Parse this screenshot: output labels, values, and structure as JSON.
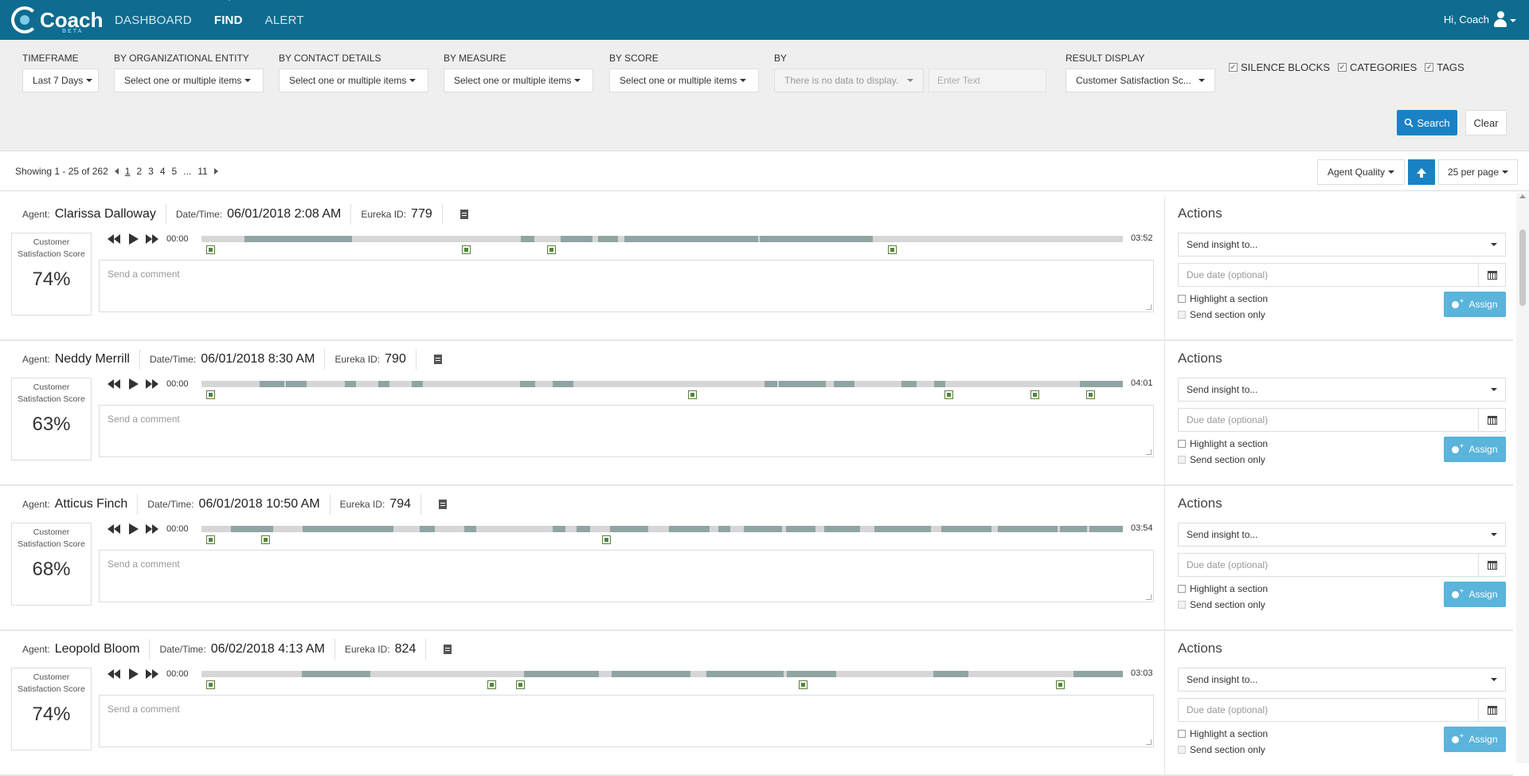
{
  "app": {
    "logo_text": "Coach",
    "logo_sub": "BETA",
    "nav": [
      {
        "label": "DASHBOARD",
        "active": false
      },
      {
        "label": "FIND",
        "active": true
      },
      {
        "label": "ALERT",
        "active": false
      }
    ],
    "greeting": "Hi, Coach"
  },
  "filters": {
    "timeframe": {
      "label": "TIMEFRAME",
      "value": "Last 7 Days"
    },
    "org_entity": {
      "label": "BY ORGANIZATIONAL ENTITY",
      "value": "Select one or multiple items"
    },
    "contact": {
      "label": "BY CONTACT DETAILS",
      "value": "Select one or multiple items"
    },
    "measure": {
      "label": "BY MEASURE",
      "value": "Select one or multiple items"
    },
    "score": {
      "label": "BY SCORE",
      "value": "Select one or multiple items"
    },
    "by": {
      "label": "BY",
      "value": "There is no data to display.",
      "text_placeholder": "Enter Text"
    },
    "result_display": {
      "label": "RESULT DISPLAY",
      "value": "Customer Satisfaction Sc..."
    },
    "checkboxes": [
      {
        "label": "SILENCE BLOCKS",
        "checked": true
      },
      {
        "label": "CATEGORIES",
        "checked": true
      },
      {
        "label": "TAGS",
        "checked": true
      }
    ],
    "search_label": "Search",
    "clear_label": "Clear"
  },
  "pager": {
    "showing": "Showing 1 - 25 of 262",
    "pages": [
      "1",
      "2",
      "3",
      "4",
      "5",
      "...",
      "11"
    ],
    "current_page": "1",
    "sort": "Agent Quality",
    "per_page": "25 per page"
  },
  "labels": {
    "agent": "Agent:",
    "datetime": "Date/Time:",
    "eureka": "Eureka ID:",
    "score_label": "Customer Satisfaction Score",
    "comment_placeholder": "Send a comment",
    "actions_title": "Actions",
    "send_insight": "Send insight to...",
    "due_date": "Due date (optional)",
    "highlight": "Highlight a section",
    "send_section": "Send section only",
    "assign": "Assign",
    "start_time": "00:00"
  },
  "records": [
    {
      "agent": "Clarissa Dalloway",
      "datetime": "06/01/2018 2:08 AM",
      "eureka_id": "779",
      "score": "74%",
      "duration": "03:52",
      "segments": [
        [
          0.047,
          0.163
        ],
        [
          0.347,
          0.361
        ],
        [
          0.39,
          0.424
        ],
        [
          0.43,
          0.452
        ],
        [
          0.459,
          0.604
        ],
        [
          0.606,
          0.729
        ]
      ],
      "markers": [
        0.005,
        0.283,
        0.375,
        0.745
      ]
    },
    {
      "agent": "Neddy Merrill",
      "datetime": "06/01/2018 8:30 AM",
      "eureka_id": "790",
      "score": "63%",
      "duration": "04:01",
      "segments": [
        [
          0.063,
          0.09
        ],
        [
          0.092,
          0.114
        ],
        [
          0.156,
          0.168
        ],
        [
          0.192,
          0.204
        ],
        [
          0.228,
          0.24
        ],
        [
          0.346,
          0.362
        ],
        [
          0.381,
          0.404
        ],
        [
          0.611,
          0.625
        ],
        [
          0.627,
          0.678
        ],
        [
          0.686,
          0.709
        ],
        [
          0.76,
          0.776
        ],
        [
          0.795,
          0.807
        ],
        [
          0.953,
          1.0
        ]
      ],
      "markers": [
        0.005,
        0.528,
        0.806,
        0.9,
        0.96
      ]
    },
    {
      "agent": "Atticus Finch",
      "datetime": "06/01/2018 10:50 AM",
      "eureka_id": "794",
      "score": "68%",
      "duration": "03:54",
      "segments": [
        [
          0.032,
          0.078
        ],
        [
          0.11,
          0.208
        ],
        [
          0.237,
          0.253
        ],
        [
          0.285,
          0.298
        ],
        [
          0.381,
          0.395
        ],
        [
          0.407,
          0.422
        ],
        [
          0.443,
          0.485
        ],
        [
          0.507,
          0.551
        ],
        [
          0.561,
          0.574
        ],
        [
          0.589,
          0.63
        ],
        [
          0.634,
          0.666
        ],
        [
          0.676,
          0.715
        ],
        [
          0.73,
          0.792
        ],
        [
          0.803,
          0.857
        ],
        [
          0.864,
          0.929
        ],
        [
          0.932,
          0.961
        ],
        [
          0.964,
          1.0
        ]
      ],
      "markers": [
        0.005,
        0.065,
        0.435
      ]
    },
    {
      "agent": "Leopold Bloom",
      "datetime": "06/02/2018 4:13 AM",
      "eureka_id": "824",
      "score": "74%",
      "duration": "03:03",
      "segments": [
        [
          0.109,
          0.183
        ],
        [
          0.35,
          0.431
        ],
        [
          0.445,
          0.531
        ],
        [
          0.548,
          0.632
        ],
        [
          0.635,
          0.689
        ],
        [
          0.794,
          0.832
        ],
        [
          0.946,
          1.0
        ]
      ],
      "markers": [
        0.005,
        0.31,
        0.341,
        0.648,
        0.927
      ]
    }
  ]
}
